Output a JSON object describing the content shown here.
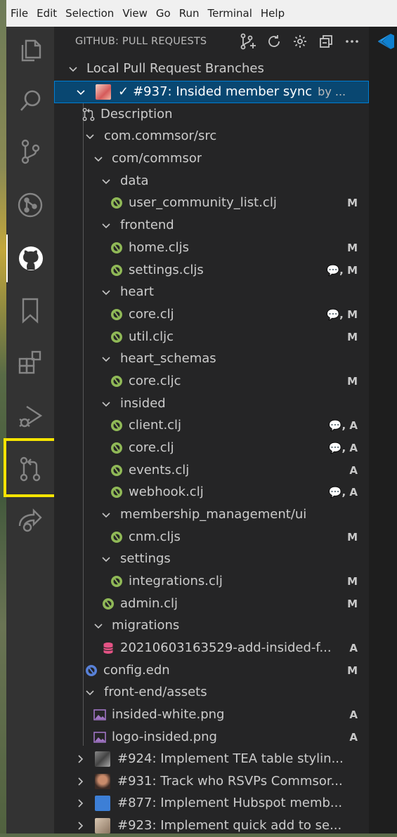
{
  "menubar": {
    "items": [
      "File",
      "Edit",
      "Selection",
      "View",
      "Go",
      "Run",
      "Terminal",
      "Help"
    ]
  },
  "activity_bar": {
    "items": [
      "files-icon",
      "search-icon",
      "source-control-icon",
      "git-graph-icon",
      "github-icon",
      "bookmark-icon",
      "extensions-icon",
      "run-debug-icon",
      "pull-request-icon",
      "live-share-icon"
    ],
    "highlight_color": "#f5e400"
  },
  "sidebar": {
    "title": "GITHUB: PULL REQUESTS",
    "section": "Local Pull Request Branches",
    "selected_pr": {
      "check": "✓",
      "title": "#937: Insided member sync",
      "author": "by ..."
    },
    "description": "Description",
    "tree": {
      "root_src": "com.commsor/src",
      "com_commsor": "com/commsor",
      "data": "data",
      "user_community_list": "user_community_list.clj",
      "frontend": "frontend",
      "home": "home.cljs",
      "settings_cljs": "settings.cljs",
      "heart": "heart",
      "heart_core": "core.clj",
      "heart_util": "util.cljc",
      "heart_schemas": "heart_schemas",
      "schemas_core": "core.cljc",
      "insided": "insided",
      "client": "client.clj",
      "insided_core": "core.clj",
      "events": "events.clj",
      "webhook": "webhook.clj",
      "membership": "membership_management/ui",
      "cnm": "cnm.cljs",
      "settings_folder": "settings",
      "integrations": "integrations.clj",
      "admin": "admin.clj",
      "migrations": "migrations",
      "migration_file": "20210603163529-add-insided-f...",
      "config": "config.edn",
      "frontend_assets": "front-end/assets",
      "insided_white": "insided-white.png",
      "logo_insided": "logo-insided.png"
    },
    "badges": {
      "M": "M",
      "A": "A",
      "comment_M": "💬, M",
      "comment_A": "💬, A"
    },
    "other_prs": [
      "#924: Implement TEA table stylin...",
      "#931: Track who RSVPs Commsor...",
      "#877: Implement Hubspot memb...",
      "#923: Implement quick add to se..."
    ]
  },
  "colors": {
    "clojure_green": "#90b957",
    "clojure_blue": "#5881d8",
    "selection_bg": "#094771",
    "vscode_blue": "#0e80d0",
    "db_pink": "#e55385"
  }
}
